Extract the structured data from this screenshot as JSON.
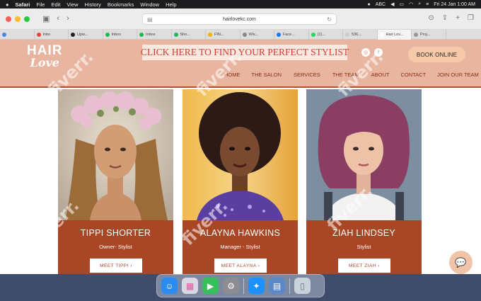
{
  "menubar": {
    "apple": "",
    "app": "Safari",
    "items": [
      "File",
      "Edit",
      "View",
      "History",
      "Bookmarks",
      "Window",
      "Help"
    ],
    "input_source": "ABC",
    "datetime": "Fri 24 Jan  1:00 AM"
  },
  "browser": {
    "url": "hairlovekc.com",
    "tabs": [
      {
        "label": "",
        "color": "#4285f4"
      },
      {
        "label": "Inbo",
        "color": "#ea4335"
      },
      {
        "label": "Upw...",
        "color": "#222222"
      },
      {
        "label": "Inbox",
        "color": "#1db954"
      },
      {
        "label": "Inbox",
        "color": "#1db954"
      },
      {
        "label": "Sho...",
        "color": "#1db954"
      },
      {
        "label": "FIN...",
        "color": "#f4b400"
      },
      {
        "label": "Wix...",
        "color": "#888888"
      },
      {
        "label": "Face...",
        "color": "#1877f2"
      },
      {
        "label": "(1)...",
        "color": "#25d366"
      },
      {
        "label": "536...",
        "color": "#cccccc"
      },
      {
        "label": "Hair Lov...",
        "color": "#ffffff",
        "active": true
      },
      {
        "label": "Proj...",
        "color": "#999999"
      }
    ]
  },
  "site": {
    "logo_line1": "HAIR",
    "logo_line2": "Love",
    "promo": "CLICK HERE TO FIND YOUR PERFECT STYLIST",
    "book_button": "BOOK ONLINE",
    "nav": [
      "HOME",
      "THE SALON",
      "SERVICES",
      "THE TEAM",
      "ABOUT",
      "CONTACT",
      "JOIN OUR TEAM"
    ],
    "stylists": [
      {
        "name": "TIPPI SHORTER",
        "role": "Owner- Stylist",
        "button": "MEET TIPPI  ›"
      },
      {
        "name": "ALAYNA HAWKINS",
        "role": "Manager - Stylist",
        "button": "MEET ALAYNA  ›"
      },
      {
        "name": "ZIAH LINDSEY",
        "role": "Stylist",
        "button": "MEET ZIAH  ›"
      }
    ]
  },
  "watermark": "fiverr.",
  "colors": {
    "header_bg": "#e8b6a0",
    "accent_rust": "#a84626",
    "promo_text": "#d83b2a"
  }
}
